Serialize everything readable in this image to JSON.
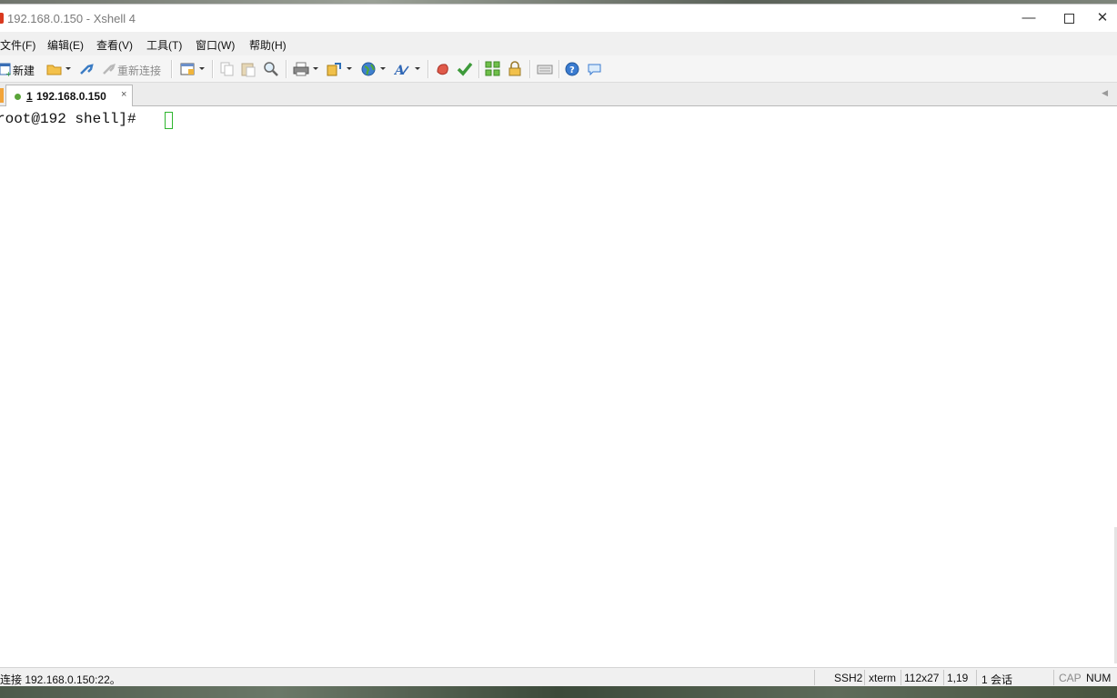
{
  "window": {
    "title": "192.168.0.150 - Xshell 4"
  },
  "menu": [
    "文件(F)",
    "编辑(E)",
    "查看(V)",
    "工具(T)",
    "窗口(W)",
    "帮助(H)"
  ],
  "toolbar": {
    "new_label": "新建",
    "reconnect_label": "重新连接",
    "icons": [
      "new-session-icon",
      "open-folder-icon",
      "connect-icon",
      "reconnect-icon",
      "properties-icon",
      "copy-icon",
      "paste-icon",
      "find-icon",
      "print-icon",
      "transfer-icon",
      "globe-icon",
      "font-icon",
      "xftp-icon",
      "xmanager-icon",
      "fullscreen-icon",
      "lock-icon",
      "keyboard-icon",
      "help-icon",
      "chat-icon"
    ]
  },
  "tab": {
    "number": "1",
    "label": "192.168.0.150",
    "close": "×"
  },
  "terminal": {
    "line": "root@192 shell]# "
  },
  "status": {
    "connection": "连接 192.168.0.150:22。",
    "protocol": "SSH2",
    "term": "xterm",
    "size": "112x27",
    "cursor_pos": "1,19",
    "sessions": "1 会话",
    "cap": "CAP",
    "num": "NUM"
  },
  "colors": {
    "cursor": "#2db52d",
    "title_icon": "#d9391f",
    "tab_dot": "#5aa43a"
  }
}
